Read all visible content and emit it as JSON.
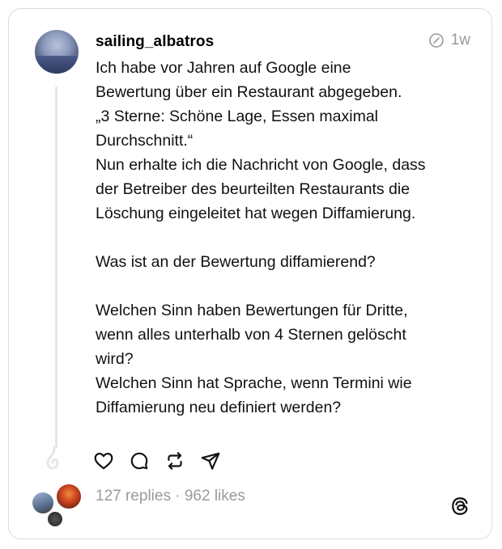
{
  "post": {
    "username": "sailing_albatros",
    "time": "1w",
    "text": "Ich habe vor Jahren auf Google eine\nBewertung über ein Restaurant abgegeben.\n„3 Sterne: Schöne Lage, Essen maximal\nDurchschnitt.“\nNun erhalte ich die Nachricht von Google, dass\nder Betreiber des beurteilten Restaurants die\nLöschung eingeleitet hat wegen Diffamierung.\n\nWas ist an der Bewertung diffamierend?\n\nWelchen Sinn haben Bewertungen für Dritte,\nwenn alles unterhalb von 4 Sternen gelöscht\nwird?\nWelchen Sinn hat Sprache, wenn Termini wie\nDiffamierung  neu definiert werden?",
    "stats": "127 replies · 962 likes"
  },
  "icons": {
    "edited": "pencil-circle-icon",
    "like": "heart-icon",
    "reply": "comment-icon",
    "repost": "repost-icon",
    "share": "send-icon",
    "brand": "threads-logo-icon"
  }
}
